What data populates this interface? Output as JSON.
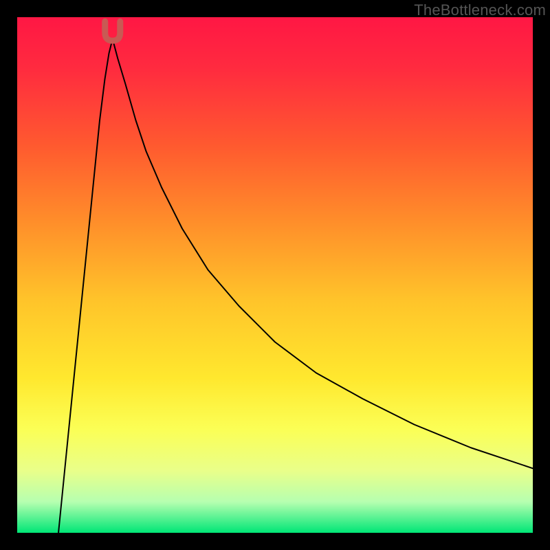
{
  "watermark": "TheBottleneck.com",
  "chart_data": {
    "type": "line",
    "title": "",
    "xlabel": "",
    "ylabel": "",
    "xlim": [
      0,
      100
    ],
    "ylim": [
      0,
      100
    ],
    "grid": false,
    "gradient_stops": [
      {
        "offset": 0.0,
        "color": "#ff1744"
      },
      {
        "offset": 0.1,
        "color": "#ff2b3f"
      },
      {
        "offset": 0.25,
        "color": "#ff5a2f"
      },
      {
        "offset": 0.4,
        "color": "#ff8f2a"
      },
      {
        "offset": 0.55,
        "color": "#ffc42a"
      },
      {
        "offset": 0.7,
        "color": "#ffe82e"
      },
      {
        "offset": 0.8,
        "color": "#fbff56"
      },
      {
        "offset": 0.88,
        "color": "#e9ff8a"
      },
      {
        "offset": 0.94,
        "color": "#b6ffb0"
      },
      {
        "offset": 1.0,
        "color": "#00e676"
      }
    ],
    "dip_marker": {
      "x": 18.5,
      "y": 96.5,
      "stroke": "#c85a54",
      "stroke_width": 9
    },
    "series": [
      {
        "name": "left-branch",
        "stroke": "#000000",
        "stroke_width": 2,
        "x": [
          8.0,
          9.0,
          10.0,
          11.0,
          12.0,
          13.0,
          14.0,
          15.0,
          16.0,
          17.0,
          17.8,
          18.3
        ],
        "y": [
          0.0,
          10.0,
          20.0,
          30.0,
          40.0,
          50.0,
          60.0,
          70.0,
          80.0,
          88.0,
          93.0,
          95.0
        ]
      },
      {
        "name": "right-branch",
        "stroke": "#000000",
        "stroke_width": 2,
        "x": [
          18.7,
          19.5,
          21.0,
          23.0,
          25.0,
          28.0,
          32.0,
          37.0,
          43.0,
          50.0,
          58.0,
          67.0,
          77.0,
          88.0,
          100.0
        ],
        "y": [
          95.0,
          92.0,
          87.0,
          80.0,
          74.0,
          67.0,
          59.0,
          51.0,
          44.0,
          37.0,
          31.0,
          26.0,
          21.0,
          16.5,
          12.5
        ]
      }
    ]
  }
}
